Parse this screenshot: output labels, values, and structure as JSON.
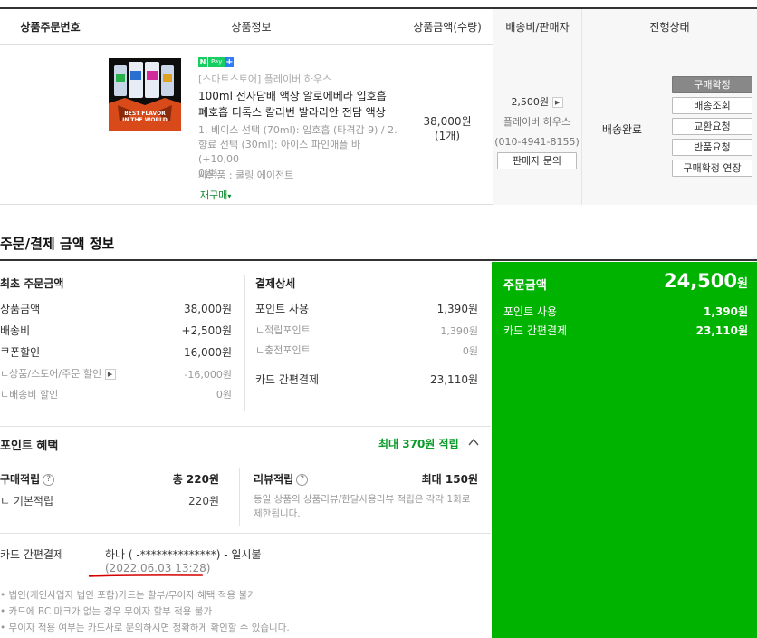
{
  "table_header": {
    "order_no": "상품주문번호",
    "product_info": "상품정보",
    "price_qty": "상품금액(수량)",
    "ship_seller": "배송비/판매자",
    "status": "진행상태"
  },
  "item": {
    "npay_n": "N",
    "npay_pay": "Pay",
    "npay_plus": "+",
    "store": "[스마트스토어] 플레이버 하우스",
    "name_line1": "100ml 전자담배 액상 알로에베라 입호흡",
    "name_line2": "폐호흡 디톡스 칼리번 발라리안 전담 액상",
    "option_line1": "1. 베이스 선택 (70ml): 입호흡 (타격감 9) / 2.",
    "option_line2": "향료 선택 (30ml): 아이스 파인애플 바 (+10,00",
    "option_line3": "0원)",
    "gift": "사은품 : 쿨링 에이전트",
    "rebuy": "재구매",
    "thumb_text1": "BEST FLAVOR",
    "thumb_text2": "IN THE WORLD",
    "price": "38,000원",
    "qty": "(1개)",
    "ship_fee": "2,500원",
    "seller": "플레이버 하우스",
    "phone": "(010-4941-8155)",
    "seller_inquiry": "판매자 문의",
    "status": "배송완료",
    "buttons": [
      "구매확정",
      "배송조회",
      "교환요청",
      "반품요청",
      "구매확정 연장"
    ]
  },
  "summary": {
    "title": "주문/결제 금액 정보",
    "initial": {
      "title": "최초 주문금액",
      "rows": [
        {
          "label": "상품금액",
          "value": "38,000원"
        },
        {
          "label": "배송비",
          "value": "+2,500원"
        },
        {
          "label": "쿠폰할인",
          "value": "-16,000원"
        },
        {
          "label": "ㄴ상품/스토어/주문 할인",
          "value": "-16,000원"
        },
        {
          "label": "ㄴ배송비 할인",
          "value": "0원"
        }
      ]
    },
    "detail": {
      "title": "결제상세",
      "rows": [
        {
          "label": "포인트 사용",
          "value": "1,390원"
        },
        {
          "label": "ㄴ적립포인트",
          "value": "1,390원"
        },
        {
          "label": "ㄴ충전포인트",
          "value": "0원"
        },
        {
          "label": "카드 간편결제",
          "value": "23,110원"
        }
      ]
    },
    "total": {
      "label": "주문금액",
      "amount": "24,500",
      "unit": "원",
      "rows": [
        {
          "label": "포인트 사용",
          "value": "1,390원"
        },
        {
          "label": "카드 간편결제",
          "value": "23,110원"
        }
      ]
    }
  },
  "points": {
    "title": "포인트 혜택",
    "max": "최대 370원 적립",
    "purchase_label": "구매적립",
    "purchase_value": "총 220원",
    "basic_label": "ㄴ 기본적립",
    "basic_value": "220원",
    "review_label": "리뷰적립",
    "review_value": "최대 150원",
    "review_note1": "동일 상품의 상품리뷰/한달사용리뷰 적립은 각각 1회로",
    "review_note2": "제한됩니다."
  },
  "card": {
    "label": "카드 간편결제",
    "value": "하나 (          -**************) - 일시불",
    "date": "(2022.06.03 13:28)"
  },
  "notes": [
    "• 법인(개인사업자 법인 포함)카드는 할부/무이자 혜택 적용 불가",
    "• 카드에 BC 마크가 없는 경우 무이자 할부 적용 불가",
    "• 무이자 적용 여부는 카드사로 문의하시면 정확하게 확인할 수 있습니다."
  ],
  "colors": {
    "green_panel": "#00b300",
    "accent_green": "#0a9a2a",
    "annotation_red": "#d40000"
  }
}
